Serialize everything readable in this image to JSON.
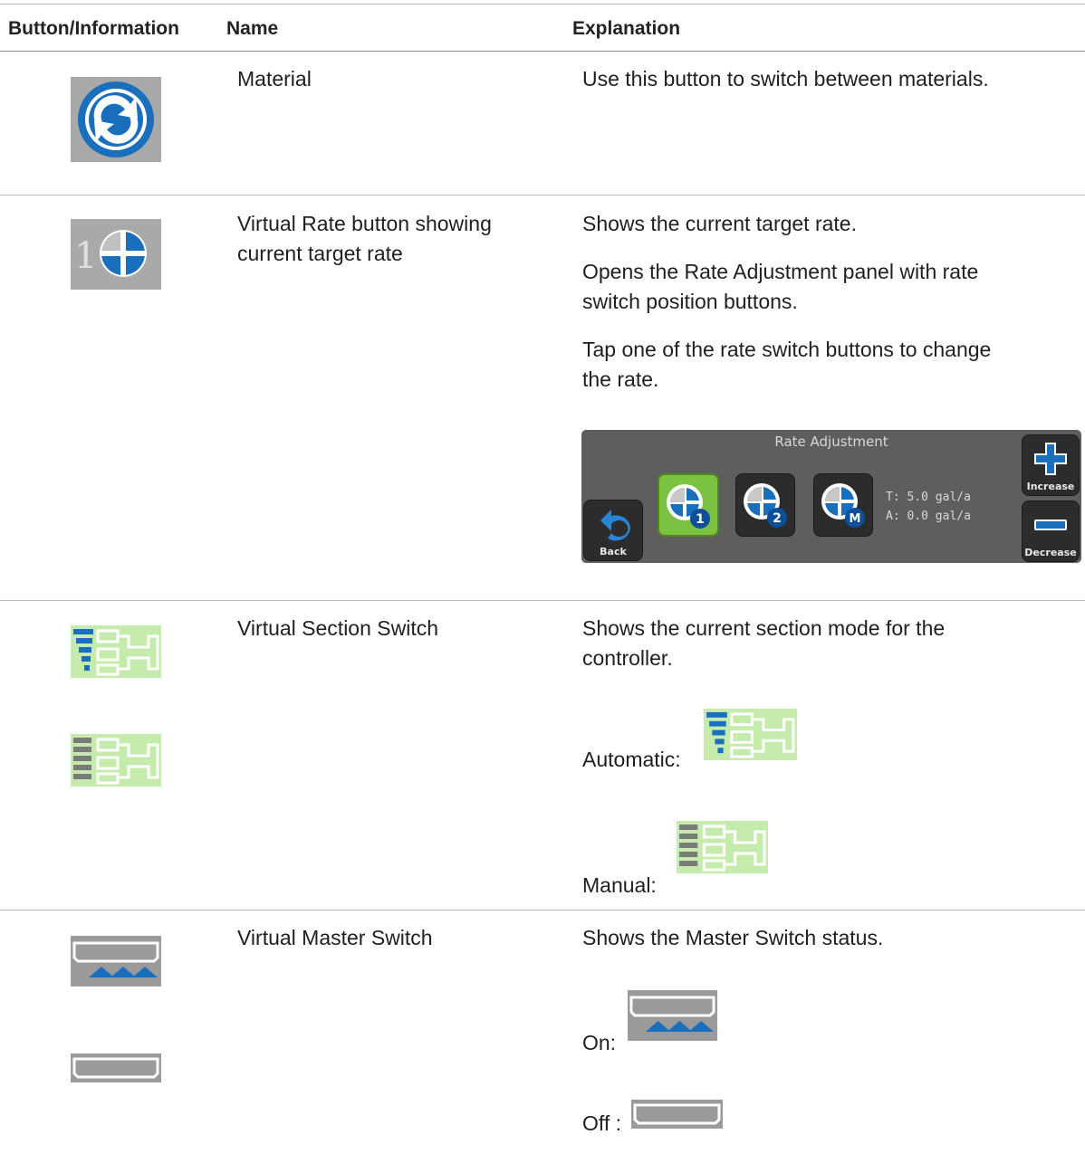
{
  "header": {
    "col1": "Button/Information",
    "col2": "Name",
    "col3": "Explanation"
  },
  "rows": {
    "material": {
      "name": "Material",
      "explanation": "Use this button to switch between materials."
    },
    "rate": {
      "name_line1": "Virtual Rate button showing",
      "name_line2": "current target rate",
      "explanation1": "Shows the current target rate.",
      "explanation2_line1": "Opens the Rate Adjustment panel with rate",
      "explanation2_line2": "switch position buttons.",
      "explanation3_line1": "Tap one of the rate switch buttons to change",
      "explanation3_line2": "the rate.",
      "icon_digit": "1"
    },
    "panel": {
      "title": "Rate Adjustment",
      "back_label": "Back",
      "increase_label": "Increase",
      "decrease_label": "Decrease",
      "badge1": "1",
      "badge2": "2",
      "badgeM": "M",
      "target": "T: 5.0 gal/a",
      "actual": "A: 0.0 gal/a"
    },
    "section": {
      "name": "Virtual Section Switch",
      "explanation_line1": "Shows the current section mode for the",
      "explanation_line2": "controller.",
      "automatic_label": "Automatic:",
      "manual_label": "Manual:"
    },
    "master": {
      "name": "Virtual Master Switch",
      "explanation": "Shows the Master Switch status.",
      "on_label": "On:",
      "off_label": "Off :"
    }
  },
  "colors": {
    "blue": "#1a6fbd",
    "green_bg": "#c6ecad",
    "gray_bg": "#9a9a9a",
    "selected_green": "#7cc242",
    "panel_bg": "#5e5e5e"
  }
}
